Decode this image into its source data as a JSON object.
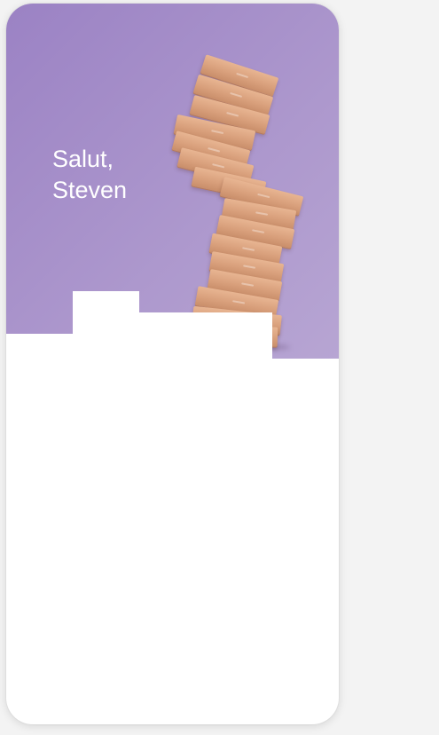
{
  "greeting": {
    "line1": "Salut,",
    "line2": "Steven"
  },
  "colors": {
    "hero_start": "#9b82c4",
    "hero_end": "#b7a5d3",
    "background": "#f3f3f3",
    "card": "#ffffff"
  },
  "hero_image": {
    "icon": "box-stack-illustration"
  }
}
